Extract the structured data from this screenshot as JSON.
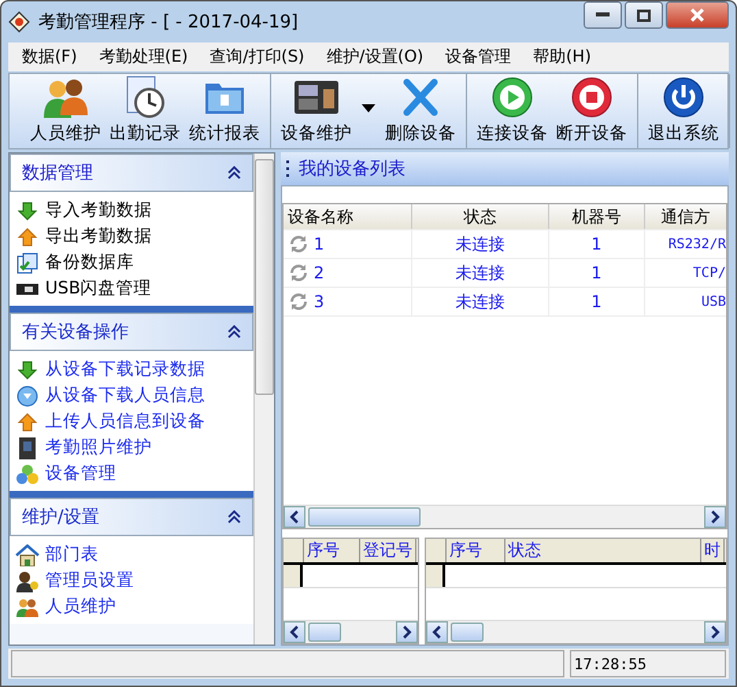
{
  "window": {
    "title": "考勤管理程序 - [ - 2017-04-19]"
  },
  "menu": [
    "数据(F)",
    "考勤处理(E)",
    "查询/打印(S)",
    "维护/设置(O)",
    "设备管理",
    "帮助(H)"
  ],
  "toolbar": [
    [
      {
        "label": "人员维护",
        "kind": "people"
      },
      {
        "label": "出勤记录",
        "kind": "clock"
      },
      {
        "label": "统计报表",
        "kind": "folder"
      }
    ],
    [
      {
        "label": "设备维护",
        "kind": "device",
        "dropdown": true
      },
      {
        "label": "删除设备",
        "kind": "delete"
      }
    ],
    [
      {
        "label": "连接设备",
        "kind": "play"
      },
      {
        "label": "断开设备",
        "kind": "stop"
      }
    ],
    [
      {
        "label": "退出系统",
        "kind": "power"
      }
    ]
  ],
  "sidebar": [
    {
      "title": "数据管理",
      "expanded": true,
      "selected": true,
      "items": [
        {
          "label": "导入考勤数据",
          "kind": "down"
        },
        {
          "label": "导出考勤数据",
          "kind": "up"
        },
        {
          "label": "备份数据库",
          "kind": "backup"
        },
        {
          "label": "USB闪盘管理",
          "kind": "usb"
        }
      ]
    },
    {
      "title": "有关设备操作",
      "expanded": true,
      "selected": false,
      "items": [
        {
          "label": "从设备下载记录数据",
          "kind": "down"
        },
        {
          "label": "从设备下载人员信息",
          "kind": "download-circle"
        },
        {
          "label": "上传人员信息到设备",
          "kind": "up"
        },
        {
          "label": "考勤照片维护",
          "kind": "photo"
        },
        {
          "label": "设备管理",
          "kind": "balls"
        }
      ]
    },
    {
      "title": "维护/设置",
      "expanded": true,
      "selected": false,
      "items": [
        {
          "label": "部门表",
          "kind": "house"
        },
        {
          "label": "管理员设置",
          "kind": "admin"
        },
        {
          "label": "人员维护",
          "kind": "people"
        }
      ]
    }
  ],
  "device_list": {
    "title": "我的设备列表",
    "columns": [
      "设备名称",
      "状态",
      "机器号",
      "通信方"
    ],
    "rows": [
      {
        "name": "1",
        "status": "未连接",
        "machine": "1",
        "comm": "RS232/R"
      },
      {
        "name": "2",
        "status": "未连接",
        "machine": "1",
        "comm": "TCP/"
      },
      {
        "name": "3",
        "status": "未连接",
        "machine": "1",
        "comm": "USB"
      }
    ]
  },
  "grid_left": {
    "columns": [
      "序号",
      "登记号"
    ]
  },
  "grid_right": {
    "columns": [
      "序号",
      "状态",
      "时"
    ]
  },
  "status_bar": {
    "time": "17:28:55"
  }
}
